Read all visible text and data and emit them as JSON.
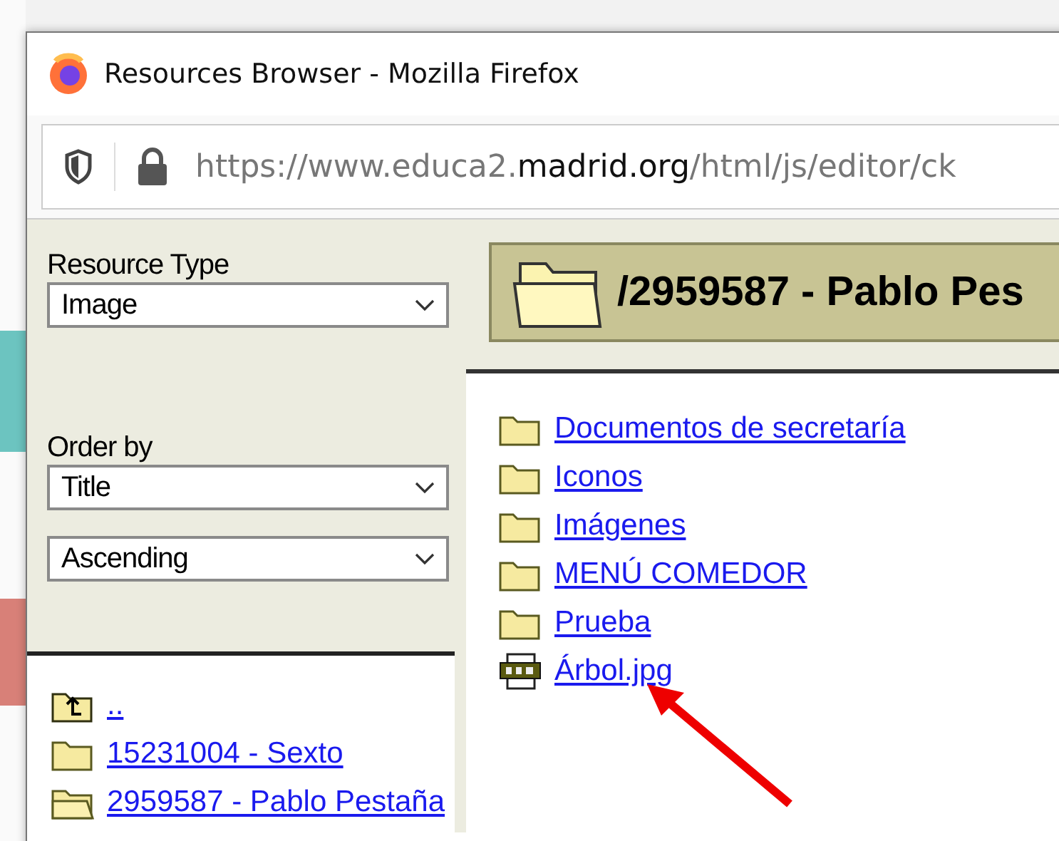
{
  "window": {
    "title": "Resources Browser - Mozilla Firefox"
  },
  "address_bar": {
    "url_prefix": "https://www.educa2.",
    "url_domain": "madrid.org",
    "url_path": "/html/js/editor/ck"
  },
  "filters": [
    {
      "label": "Resource Type",
      "value": "Image"
    },
    {
      "label": "Order by",
      "value": "Title"
    },
    {
      "value": "Ascending"
    }
  ],
  "folder_tree": [
    {
      "kind": "up",
      "name": ".."
    },
    {
      "kind": "folder",
      "name": "15231004 - Sexto"
    },
    {
      "kind": "open",
      "name": "2959587 - Pablo Pestaña"
    }
  ],
  "current_folder": {
    "path": "/2959587 - Pablo Pes"
  },
  "files": [
    {
      "kind": "folder",
      "name": "Documentos de secretaría"
    },
    {
      "kind": "folder",
      "name": "Iconos"
    },
    {
      "kind": "folder",
      "name": "Imágenes"
    },
    {
      "kind": "folder",
      "name": "MENÚ COMEDOR"
    },
    {
      "kind": "folder",
      "name": "Prueba"
    },
    {
      "kind": "jpg",
      "name": "Árbol.jpg"
    }
  ]
}
